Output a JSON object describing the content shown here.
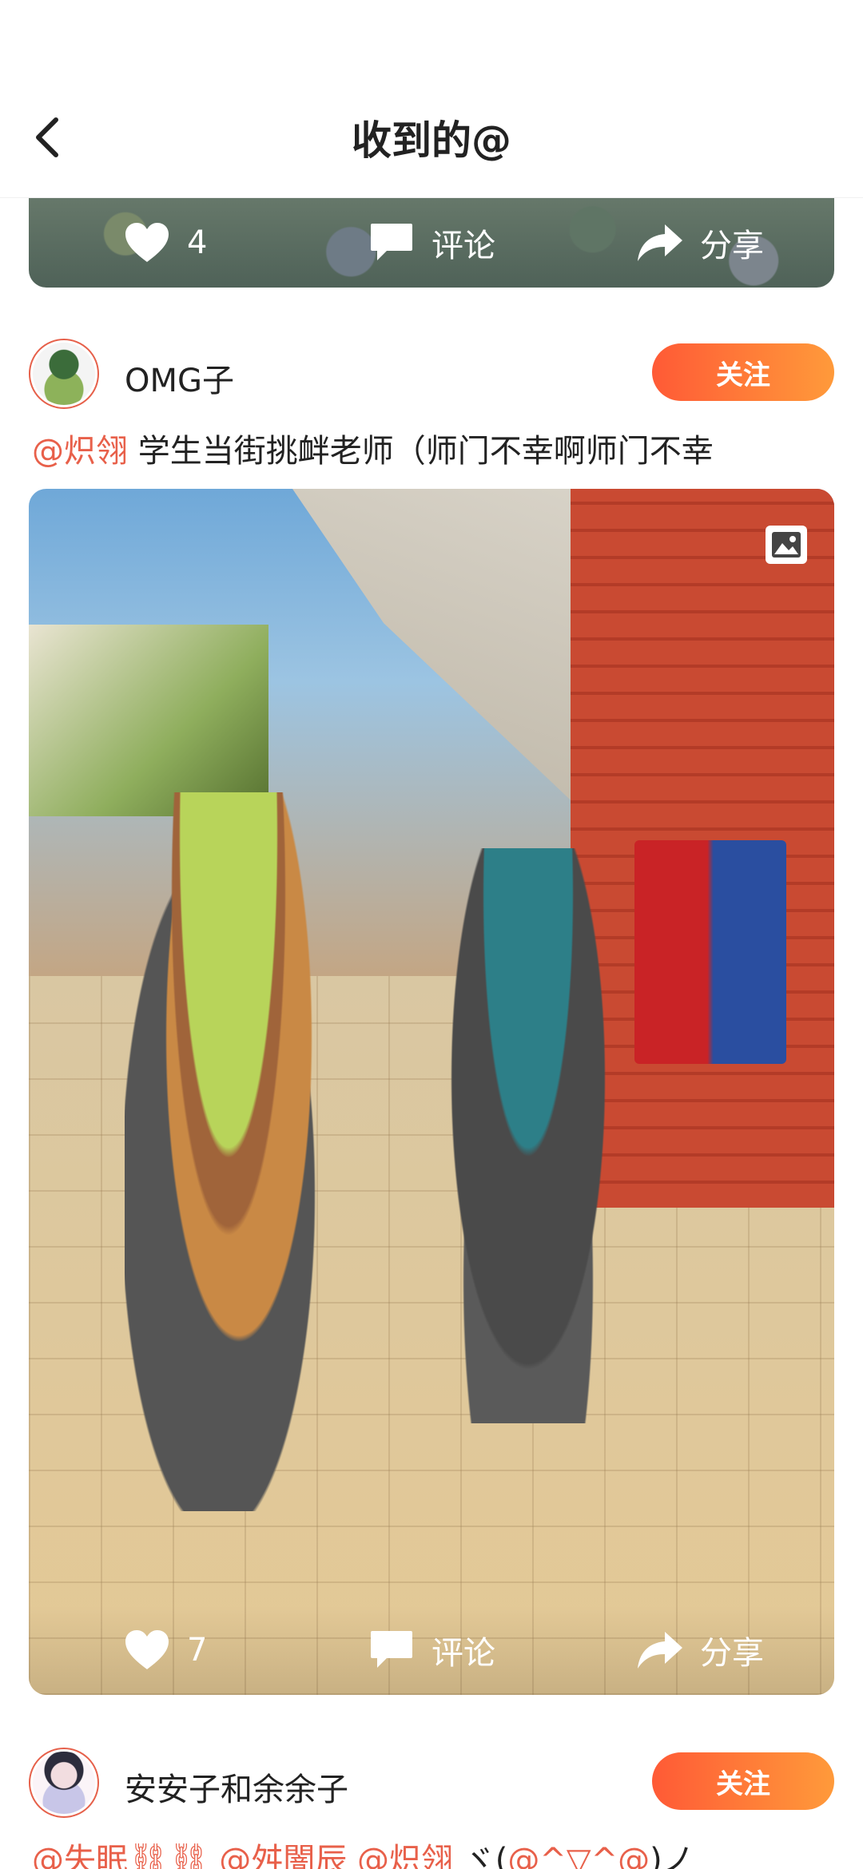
{
  "header": {
    "title": "收到的@"
  },
  "posts": [
    {
      "likes": "4",
      "comment_label": "评论",
      "share_label": "分享"
    },
    {
      "username": "OMG子",
      "follow_label": "关注",
      "text_mention": "@炽翎",
      "text_body": " 学生当街挑衅老师（师门不幸啊师门不幸",
      "likes": "7",
      "comment_label": "评论",
      "share_label": "分享"
    },
    {
      "username": "安安子和余余子",
      "follow_label": "关注",
      "text_mention_1": "@失眠⛓⛓",
      "text_mention_2": " @舛闇辰",
      "text_mention_3": " @炽翎",
      "text_body": " ヾ(",
      "text_mention_4": "@^▽^@",
      "text_tail": ")ノ"
    }
  ],
  "colors": {
    "accent": "#ff5a36",
    "mention": "#e8604a"
  },
  "icons": [
    "back-arrow-icon",
    "heart-icon",
    "comment-icon",
    "share-icon",
    "image-icon"
  ]
}
